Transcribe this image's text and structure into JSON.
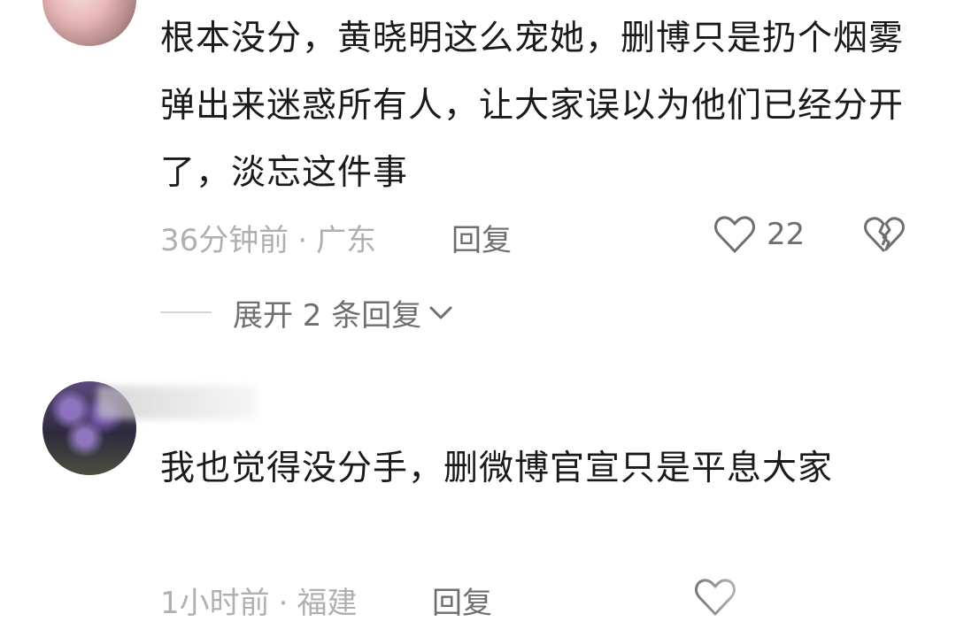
{
  "comments": [
    {
      "text": "根本没分，黄晓明这么宠她，删博只是扔个烟雾弹出来迷惑所有人，让大家误以为他们已经分开了，淡忘这件事",
      "time": "36分钟前",
      "separator": "·",
      "location": "广东",
      "reply_label": "回复",
      "likes": "22",
      "expand_label": "展开 2 条回复"
    },
    {
      "text": "我也觉得没分手，删微博官宣只是平息大家",
      "time": "1小时前",
      "separator": "·",
      "location": "福建",
      "reply_label": "回复"
    }
  ],
  "icons": {
    "like": "heart-outline-icon",
    "dislike": "broken-heart-icon",
    "expand": "chevron-down-icon"
  },
  "colors": {
    "text": "#1a1a1a",
    "meta": "#b0b0b0",
    "action": "#6f6f6f"
  }
}
